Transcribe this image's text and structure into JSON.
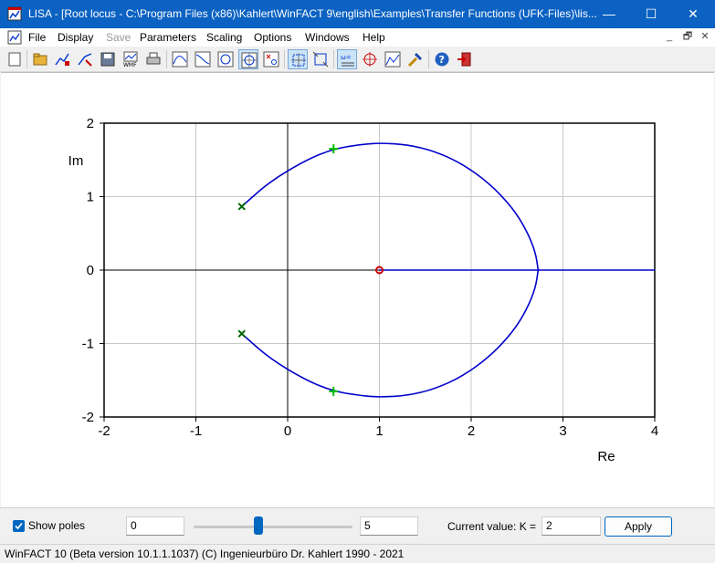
{
  "window": {
    "title": "LISA - [Root locus - C:\\Program Files (x86)\\Kahlert\\WinFACT 9\\english\\Examples\\Transfer Functions (UFK-Files)\\lis...",
    "minimize": "—",
    "maximize": "☐",
    "close": "✕"
  },
  "menu": [
    "File",
    "Display",
    "Save",
    "Parameters",
    "Scaling",
    "Options",
    "Windows",
    "Help"
  ],
  "menu_disabled": [
    "Save"
  ],
  "mdi_controls": [
    "_",
    "🗗",
    "✕"
  ],
  "toolbar_icons": [
    "new-icon",
    "open-icon",
    "curve-edit-icon",
    "marker-edit-icon",
    "save-icon",
    "export-wmf-icon",
    "print-icon",
    "frequency-response-icon",
    "step-response-icon",
    "nyquist-icon",
    "root-locus-icon",
    "pole-zero-icon",
    "zoom-auto-icon",
    "zoom-window-icon",
    "symbols-icon",
    "target-icon",
    "graph-icon",
    "settings-icon",
    "help-icon",
    "exit-icon"
  ],
  "chart_data": {
    "type": "line",
    "title": "",
    "xlabel": "Re",
    "ylabel": "Im",
    "xlim": [
      -2,
      4
    ],
    "ylim": [
      -2,
      2
    ],
    "xticks": [
      -2,
      -1,
      0,
      1,
      2,
      3,
      4
    ],
    "yticks": [
      -2,
      -1,
      0,
      1,
      2
    ],
    "grid": true,
    "series": [
      {
        "curve": "upper-branch",
        "color": "#0000cc",
        "x": [
          -0.5,
          -0.2,
          0.2,
          0.5,
          0.8,
          1.0,
          1.3,
          1.6,
          1.9,
          2.2,
          2.45,
          2.6,
          2.7,
          2.73
        ],
        "y": [
          0.866,
          1.2,
          1.5,
          1.65,
          1.71,
          1.73,
          1.71,
          1.62,
          1.45,
          1.18,
          0.85,
          0.55,
          0.25,
          0.0
        ]
      },
      {
        "curve": "lower-branch",
        "color": "#0000cc",
        "x": [
          -0.5,
          -0.2,
          0.2,
          0.5,
          0.8,
          1.0,
          1.3,
          1.6,
          1.9,
          2.2,
          2.45,
          2.6,
          2.7,
          2.73
        ],
        "y": [
          -0.866,
          -1.2,
          -1.5,
          -1.65,
          -1.71,
          -1.73,
          -1.71,
          -1.62,
          -1.45,
          -1.18,
          -0.85,
          -0.55,
          -0.25,
          0.0
        ]
      },
      {
        "curve": "real-axis-branch",
        "color": "#0000cc",
        "x": [
          1.0,
          4.0
        ],
        "y": [
          0.0,
          0.0
        ]
      }
    ],
    "poles": [
      {
        "x": -0.5,
        "y": 0.866
      },
      {
        "x": -0.5,
        "y": -0.866
      }
    ],
    "zeros": [
      {
        "x": 1.0,
        "y": 0.0
      }
    ],
    "current_points": [
      {
        "x": 0.5,
        "y": 1.65
      },
      {
        "x": 0.5,
        "y": -1.65
      }
    ],
    "colors": {
      "locus": "#0000cc",
      "pole": "#006400",
      "zero": "#cc0000",
      "current": "#00bb00"
    }
  },
  "controls": {
    "show_poles_label": "Show poles",
    "show_poles_checked": true,
    "k_min": "0",
    "k_max": "5",
    "slider_fraction": 0.41,
    "current_value_label": "Current value: K =",
    "current_value": "2",
    "apply_label": "Apply"
  },
  "status": {
    "text": "WinFACT 10 (Beta version 10.1.1.1037)  (C) Ingenieurbüro Dr. Kahlert 1990 - 2021"
  }
}
